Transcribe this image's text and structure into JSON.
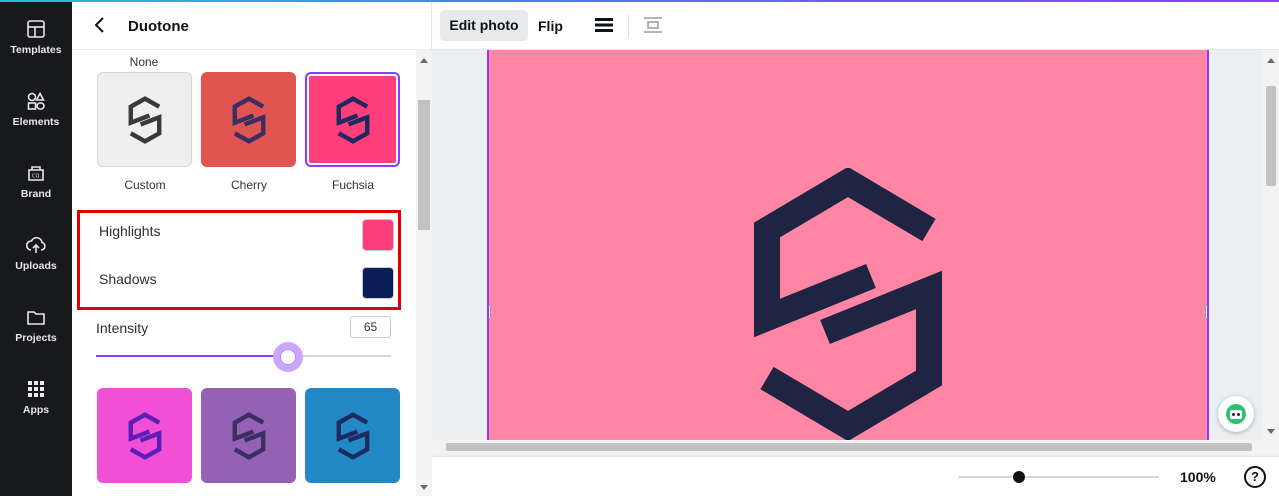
{
  "rail": {
    "items": [
      {
        "label": "Templates",
        "icon": "templates-icon"
      },
      {
        "label": "Elements",
        "icon": "elements-icon"
      },
      {
        "label": "Brand",
        "icon": "brand-icon"
      },
      {
        "label": "Uploads",
        "icon": "uploads-icon"
      },
      {
        "label": "Projects",
        "icon": "projects-icon"
      },
      {
        "label": "Apps",
        "icon": "apps-icon"
      }
    ]
  },
  "panel": {
    "title": "Duotone",
    "none_label": "None",
    "presets_top": [
      {
        "label": "Custom",
        "bg": "#efeff0",
        "fg": "#3a3a3a",
        "selected": false
      },
      {
        "label": "Cherry",
        "bg": "#e05550",
        "fg": "#3a2e63",
        "selected": false
      },
      {
        "label": "Fuchsia",
        "bg": "#ff3f7b",
        "fg": "#21275f",
        "selected": true
      }
    ],
    "presets_bottom": [
      {
        "bg": "#f04fd6",
        "fg": "#5b1fb8"
      },
      {
        "bg": "#9561b5",
        "fg": "#3a2e63"
      },
      {
        "bg": "#2389c6",
        "fg": "#1d2b5f"
      }
    ],
    "highlights_label": "Highlights",
    "highlights_color": "#ff3f7b",
    "shadows_label": "Shadows",
    "shadows_color": "#0a1d57",
    "intensity_label": "Intensity",
    "intensity_value": "65"
  },
  "toolbar": {
    "edit_photo": "Edit photo",
    "flip": "Flip"
  },
  "canvas": {
    "background": "#ff85a5",
    "logo_color": "#1f2442"
  },
  "bottom": {
    "zoom": "100%",
    "help": "?"
  }
}
